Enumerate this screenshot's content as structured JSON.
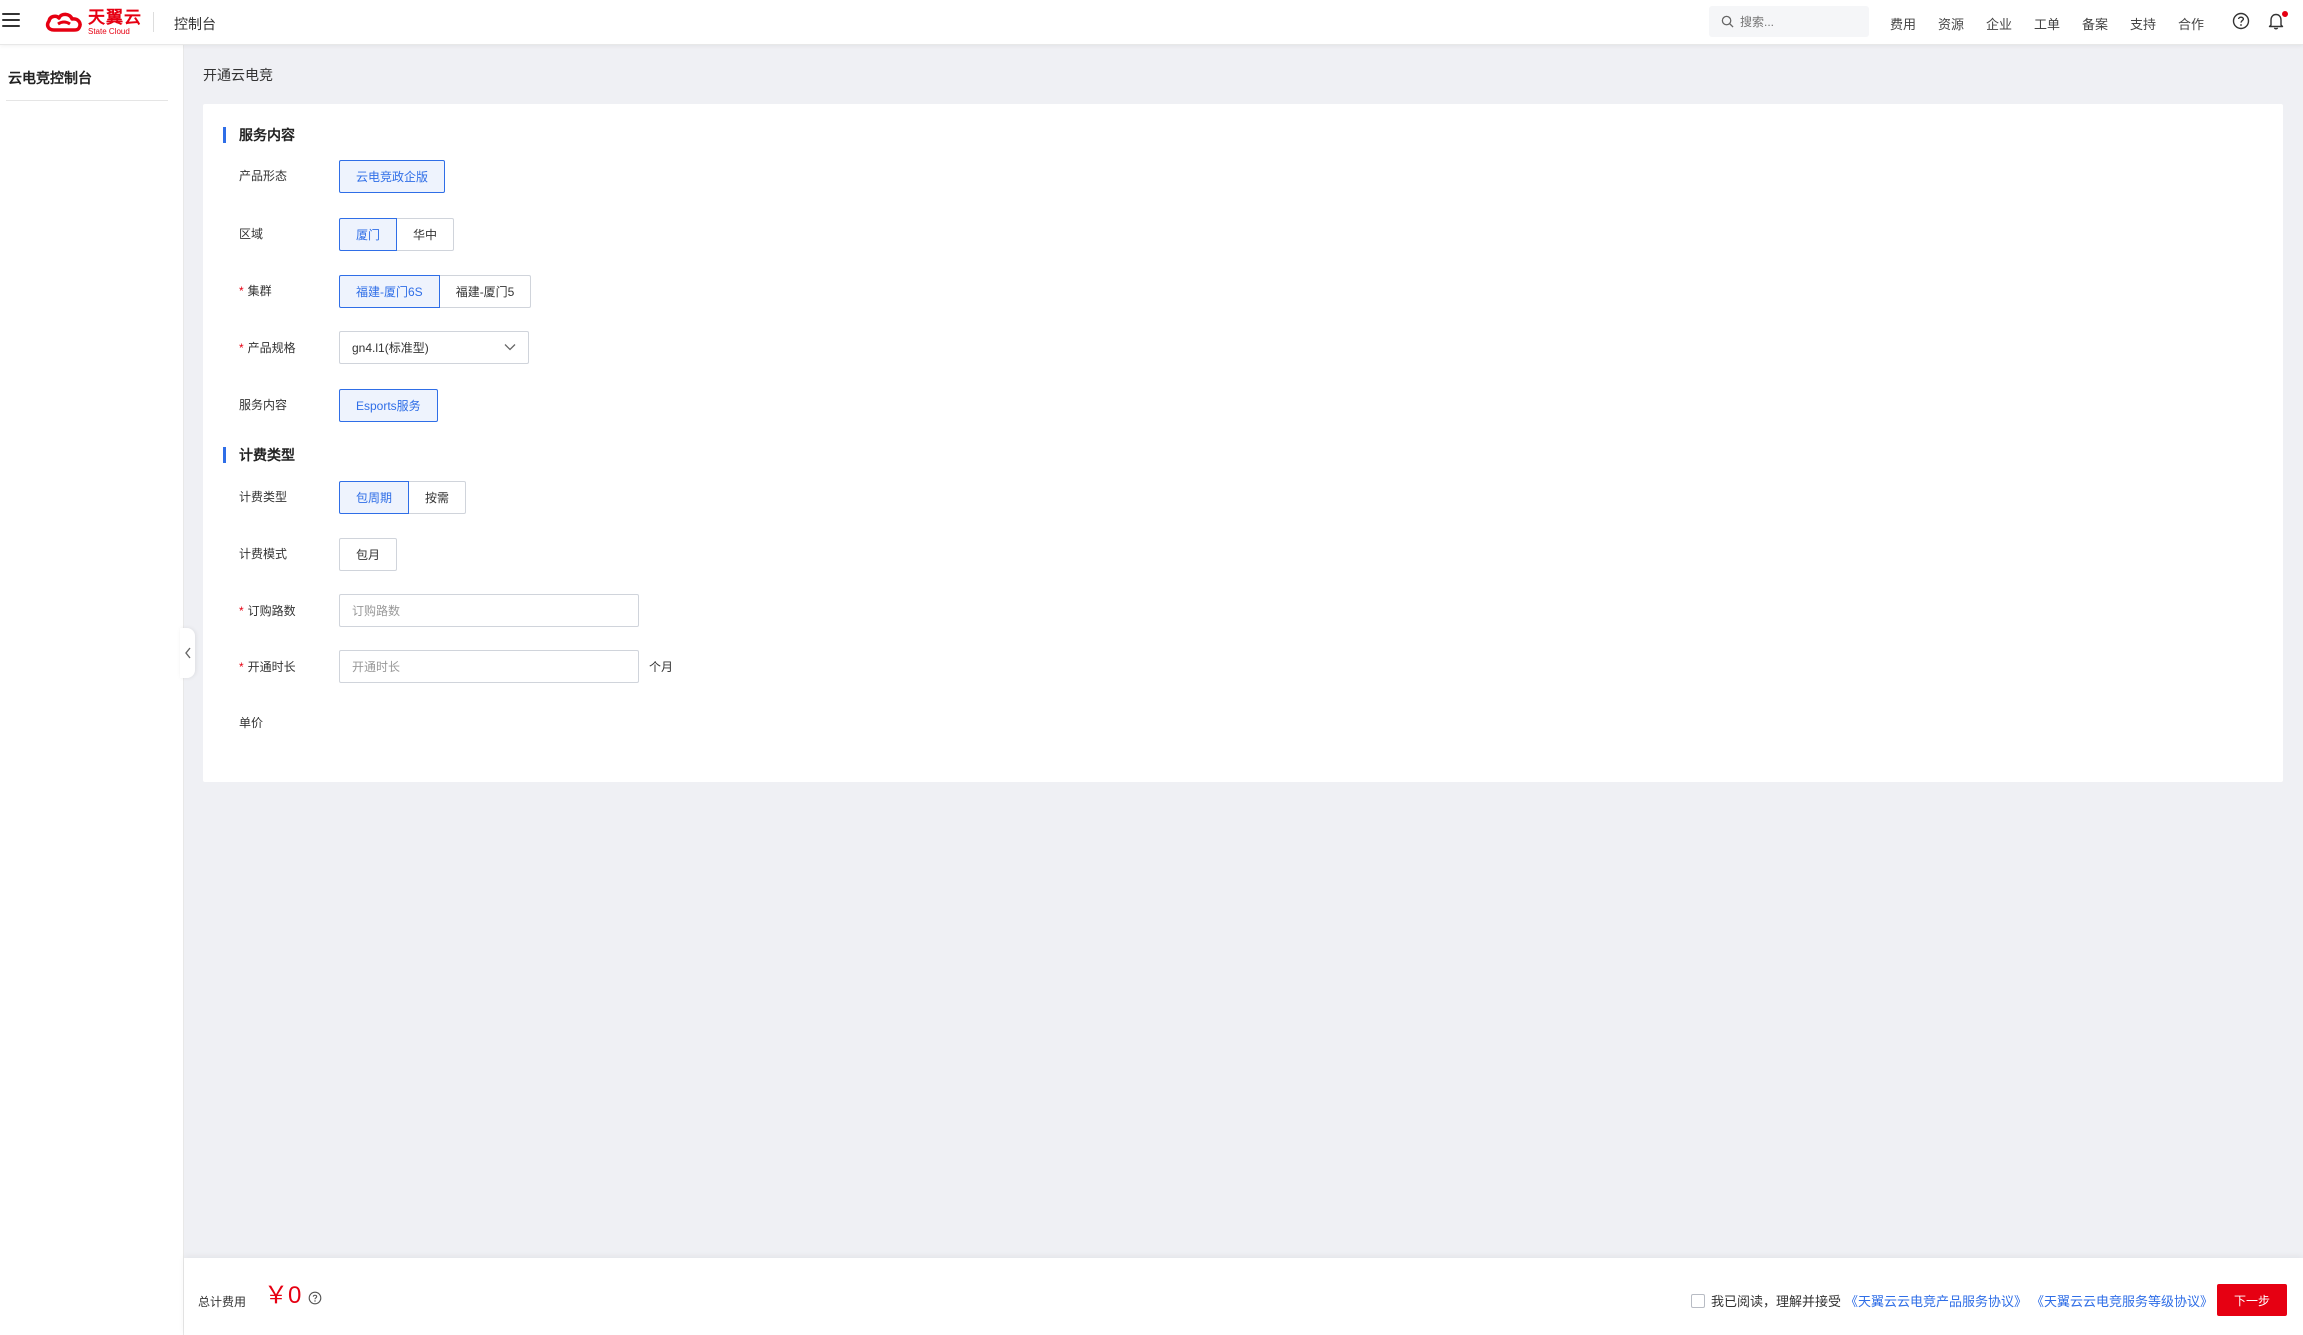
{
  "header": {
    "logo_cn": "天翼云",
    "logo_en": "State Cloud",
    "console_label": "控制台",
    "search_placeholder": "搜索...",
    "nav": [
      "费用",
      "资源",
      "企业",
      "工单",
      "备案",
      "支持",
      "合作"
    ]
  },
  "sidebar": {
    "title": "云电竞控制台"
  },
  "page": {
    "title": "开通云电竞"
  },
  "form": {
    "section_service": "服务内容",
    "product_form": {
      "label": "产品形态",
      "options": [
        "云电竞政企版"
      ],
      "selected": 0
    },
    "region": {
      "label": "区域",
      "options": [
        "厦门",
        "华中"
      ],
      "selected": 0
    },
    "cluster": {
      "label": "集群",
      "required": "*",
      "options": [
        "福建-厦门6S",
        "福建-厦门5"
      ],
      "selected": 0
    },
    "spec": {
      "label": "产品规格",
      "required": "*",
      "value": "gn4.l1(标准型)"
    },
    "service_content": {
      "label": "服务内容",
      "options": [
        "Esports服务"
      ],
      "selected": 0
    },
    "section_billing": "计费类型",
    "billing_type": {
      "label": "计费类型",
      "options": [
        "包周期",
        "按需"
      ],
      "selected": 0
    },
    "billing_mode": {
      "label": "计费模式",
      "options": [
        "包月"
      ],
      "selected": -1
    },
    "channels": {
      "label": "订购路数",
      "required": "*",
      "placeholder": "订购路数"
    },
    "duration": {
      "label": "开通时长",
      "required": "*",
      "placeholder": "开通时长",
      "unit": "个月"
    },
    "unit_price": {
      "label": "单价"
    }
  },
  "footer": {
    "total_label": "总计费用",
    "total_amount": "￥0",
    "agree_text": "我已阅读，理解并接受",
    "link1": "《天翼云云电竞产品服务协议》",
    "link2": "《天翼云云电竞服务等级协议》",
    "next_label": "下一步"
  },
  "colors": {
    "brand_red": "#e60012",
    "accent_blue": "#2f6ee7",
    "page_bg": "#eff0f4"
  }
}
